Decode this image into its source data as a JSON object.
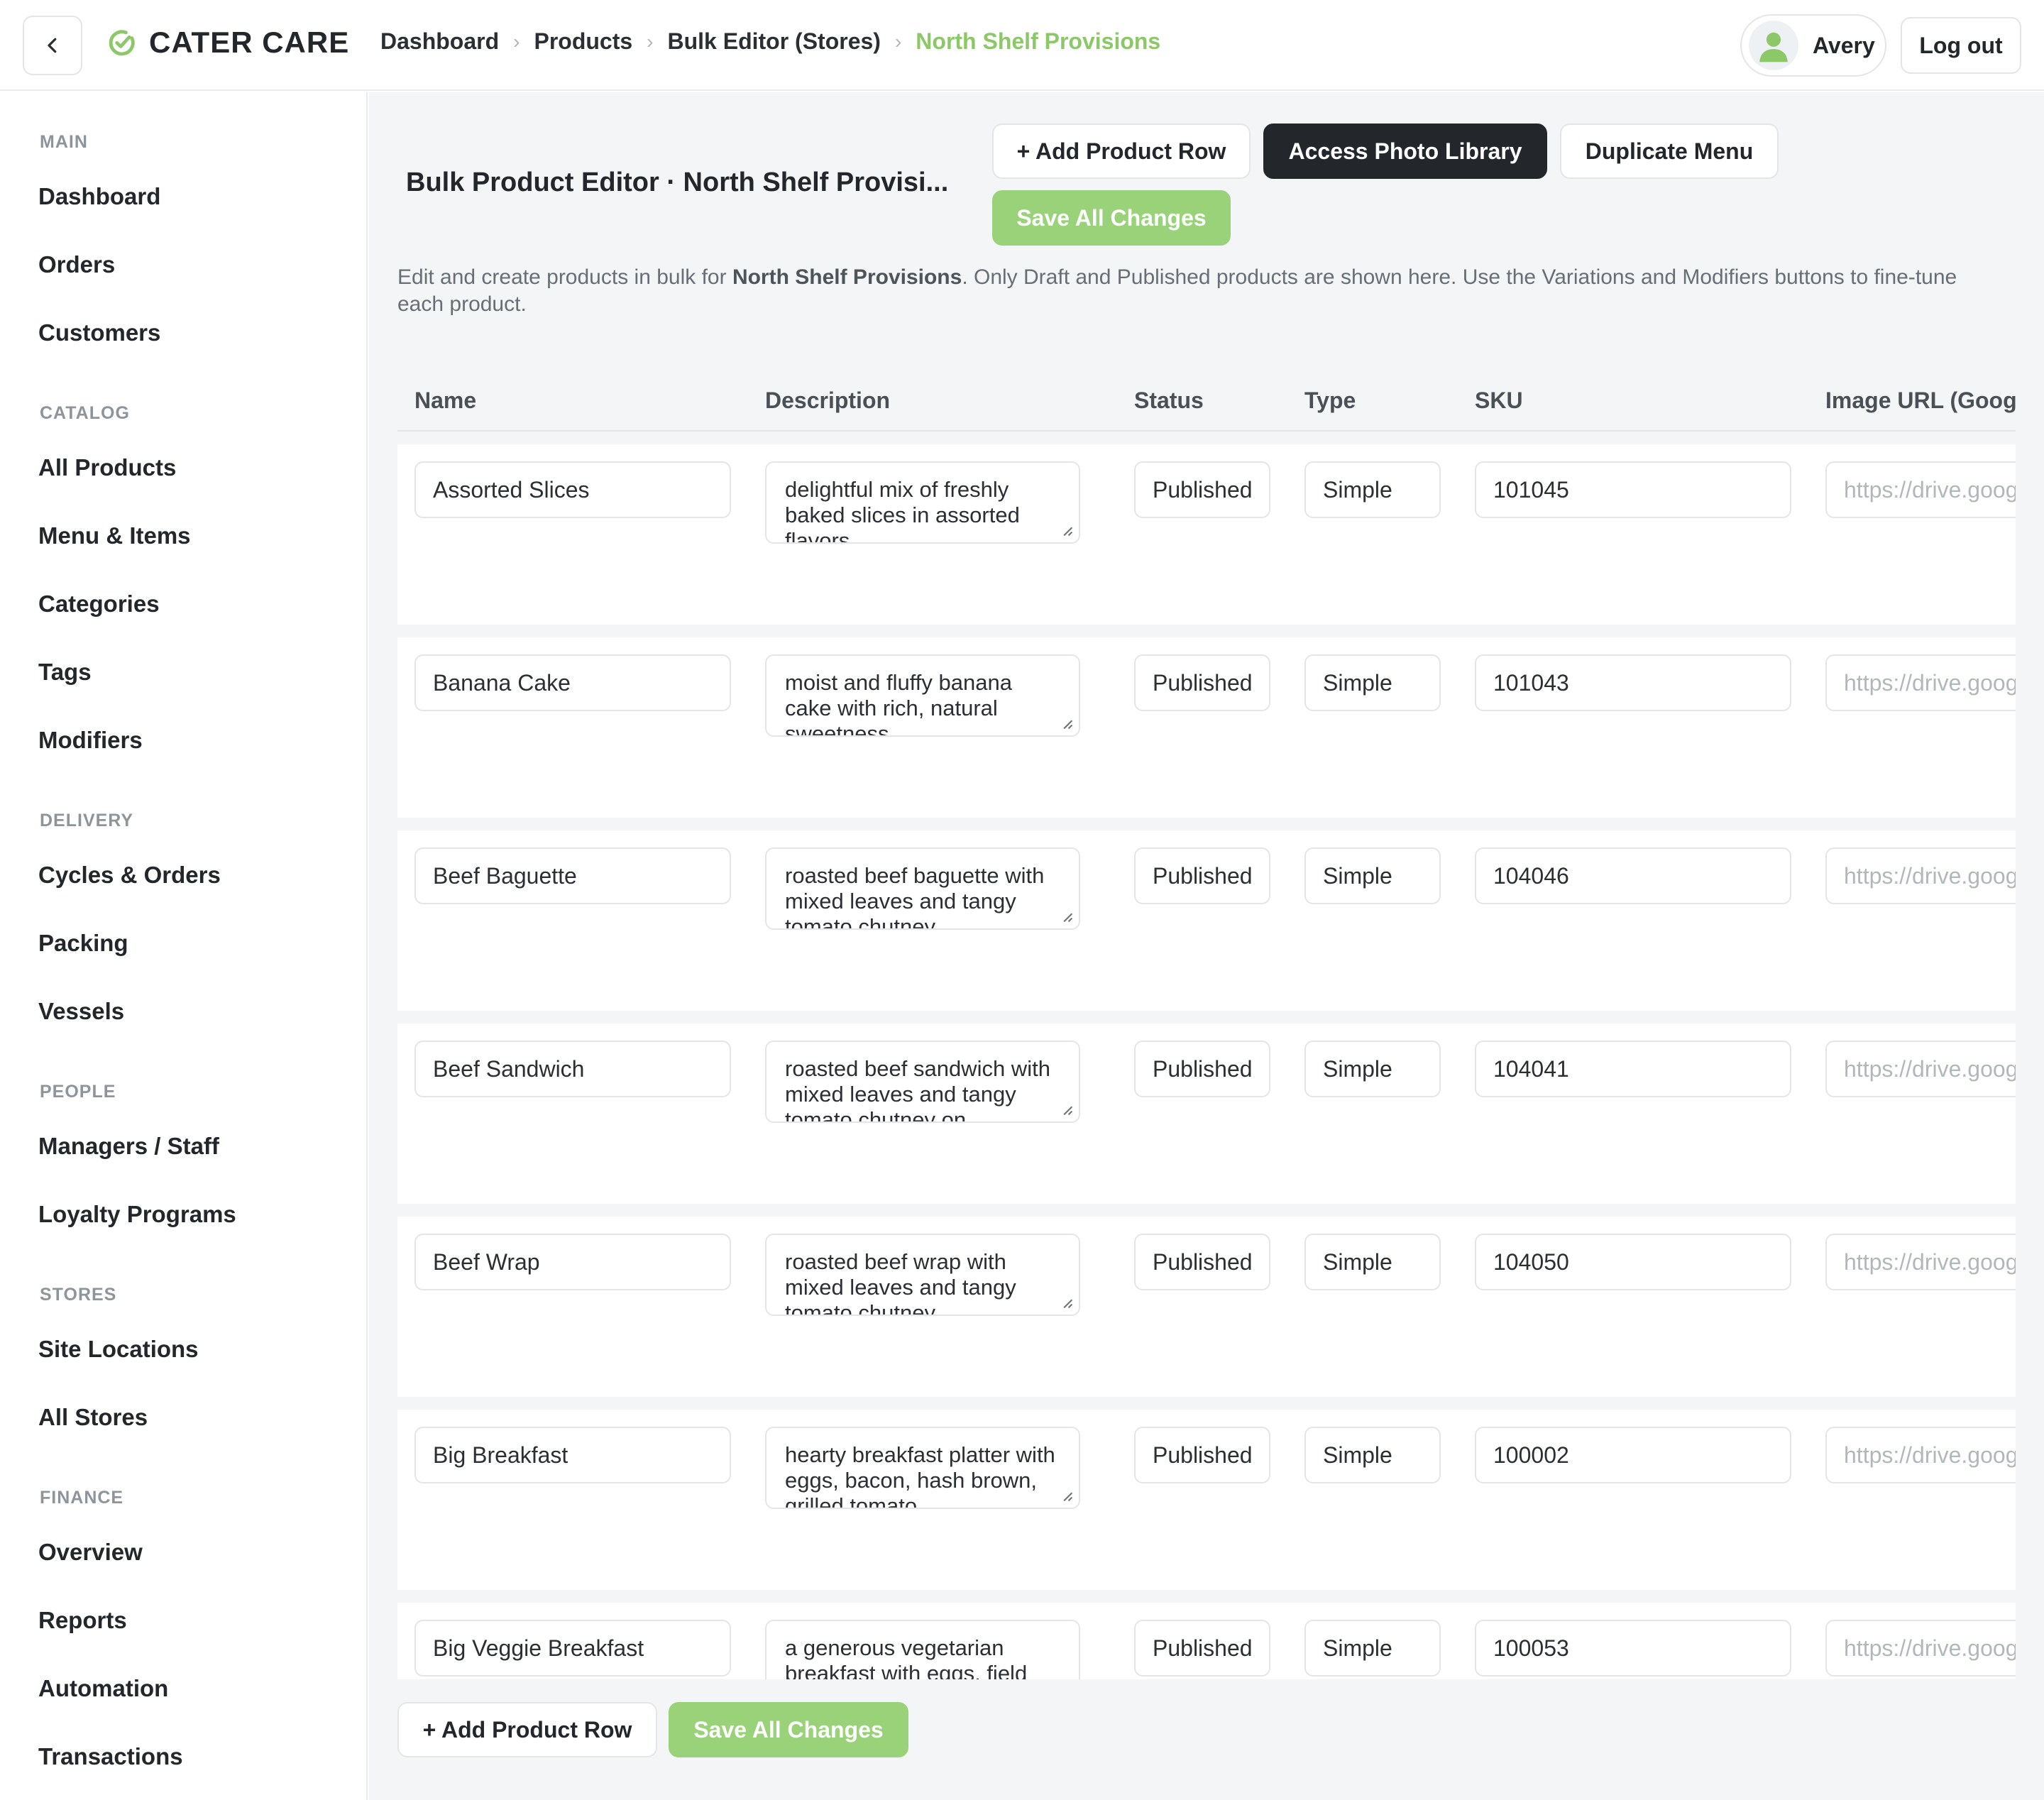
{
  "header": {
    "brand": "CATER CARE",
    "breadcrumb": [
      "Dashboard",
      "Products",
      "Bulk Editor (Stores)",
      "North Shelf Provisions"
    ],
    "user_name": "Avery",
    "logout_label": "Log out"
  },
  "sidebar": {
    "sections": [
      {
        "title": "MAIN",
        "items": [
          "Dashboard",
          "Orders",
          "Customers"
        ]
      },
      {
        "title": "CATALOG",
        "items": [
          "All Products",
          "Menu & Items",
          "Categories",
          "Tags",
          "Modifiers"
        ]
      },
      {
        "title": "DELIVERY",
        "items": [
          "Cycles & Orders",
          "Packing",
          "Vessels"
        ]
      },
      {
        "title": "PEOPLE",
        "items": [
          "Managers / Staff",
          "Loyalty Programs"
        ]
      },
      {
        "title": "STORES",
        "items": [
          "Site Locations",
          "All Stores"
        ]
      },
      {
        "title": "FINANCE",
        "items": [
          "Overview",
          "Reports",
          "Automation",
          "Transactions"
        ]
      }
    ]
  },
  "page": {
    "title": "Bulk Product Editor · North Shelf Provisi...",
    "add_row_label": "+ Add Product Row",
    "photo_library_label": "Access Photo Library",
    "duplicate_menu_label": "Duplicate Menu",
    "save_label": "Save All Changes",
    "intro_prefix": "Edit and create products in bulk for ",
    "intro_store": "North Shelf Provisions",
    "intro_suffix": ". Only Draft and Published products are shown here. Use the Variations and Modifiers buttons to fine-tune each product."
  },
  "table": {
    "columns": [
      "Name",
      "Description",
      "Status",
      "Type",
      "SKU",
      "Image URL (Goog"
    ],
    "image_placeholder": "https://drive.goog",
    "rows": [
      {
        "name": "Assorted Slices",
        "description": "delightful mix of freshly baked slices in assorted flavors",
        "status": "Published",
        "type": "Simple",
        "sku": "101045"
      },
      {
        "name": "Banana Cake",
        "description": "moist and fluffy banana cake with rich, natural sweetness",
        "status": "Published",
        "type": "Simple",
        "sku": "101043"
      },
      {
        "name": "Beef Baguette",
        "description": "roasted beef baguette with mixed leaves and tangy tomato chutney",
        "status": "Published",
        "type": "Simple",
        "sku": "104046"
      },
      {
        "name": "Beef Sandwich",
        "description": "roasted beef sandwich with mixed leaves and tangy tomato chutney on",
        "status": "Published",
        "type": "Simple",
        "sku": "104041"
      },
      {
        "name": "Beef Wrap",
        "description": "roasted beef wrap with mixed leaves and tangy tomato chutney",
        "status": "Published",
        "type": "Simple",
        "sku": "104050"
      },
      {
        "name": "Big Breakfast",
        "description": "hearty breakfast platter with eggs, bacon, hash brown, grilled tomato",
        "status": "Published",
        "type": "Simple",
        "sku": "100002"
      },
      {
        "name": "Big Veggie Breakfast",
        "description": "a generous vegetarian breakfast with eggs, field",
        "status": "Published",
        "type": "Simple",
        "sku": "100053"
      }
    ]
  },
  "colors": {
    "accent": "#8cc867",
    "button_green": "#9ad27a",
    "dark": "#23272b"
  }
}
